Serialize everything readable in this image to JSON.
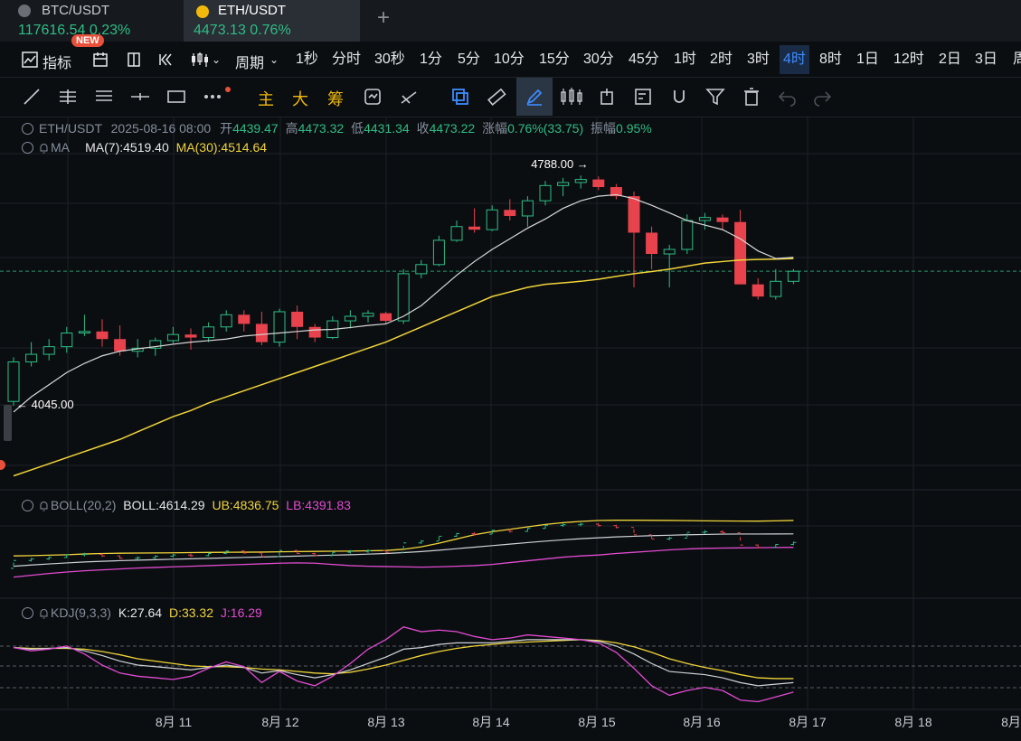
{
  "tabs": [
    {
      "symbol": "BTC/USDT",
      "price": "117616.54",
      "change": "0.23%",
      "badge": "NEW"
    },
    {
      "symbol": "ETH/USDT",
      "price": "4473.13",
      "change": "0.76%"
    }
  ],
  "toolbar": {
    "indicators_label": "指标",
    "period_label": "周期",
    "periods": [
      "1秒",
      "分时",
      "30秒",
      "1分",
      "5分",
      "10分",
      "15分",
      "30分",
      "45分",
      "1时",
      "2时",
      "3时",
      "4时",
      "8时",
      "1日",
      "12时",
      "2日",
      "3日",
      "周"
    ],
    "active_period": "4时"
  },
  "drawing_tools": {
    "main_label": "主",
    "big_label": "大",
    "chip_label": "筹"
  },
  "colors": {
    "up": "#2ebd85",
    "down": "#e8424c",
    "ma7": "#d8d8d8",
    "ma30": "#f0d43a",
    "boll_lb": "#e04bd0",
    "accent": "#3d8bfd"
  },
  "legend": {
    "symbol": "ETH/USDT",
    "datetime": "2025-08-16 08:00",
    "open_label": "开",
    "open": "4439.47",
    "high_label": "高",
    "high": "4473.32",
    "low_label": "低",
    "low": "4431.34",
    "close_label": "收",
    "close": "4473.22",
    "change_label": "涨幅",
    "change": "0.76%(33.75)",
    "amplitude_label": "振幅",
    "amplitude": "0.95%",
    "ma_name": "MA",
    "ma7": "MA(7):4519.40",
    "ma30": "MA(30):4514.64",
    "boll_name": "BOLL(20,2)",
    "boll": "BOLL:4614.29",
    "boll_ub": "UB:4836.75",
    "boll_lb": "LB:4391.83",
    "kdj_name": "KDJ(9,3,3)",
    "kdj_k": "K:27.64",
    "kdj_d": "D:33.32",
    "kdj_j": "J:16.29"
  },
  "chart_data": {
    "type": "candlestick",
    "interval": "4h",
    "x_ticks": [
      "8月 11",
      "8月 12",
      "8月 13",
      "8月 14",
      "8月 15",
      "8月 16",
      "8月 17",
      "8月 18",
      "8月"
    ],
    "price_range": [
      3790,
      4860
    ],
    "annotations": {
      "high_label": "4788.00",
      "low_label": "4045.00"
    },
    "last_price": 4473.13,
    "candles": [
      {
        "o": 4045,
        "h": 4190,
        "l": 4030,
        "c": 4175
      },
      {
        "o": 4175,
        "h": 4240,
        "l": 4160,
        "c": 4200
      },
      {
        "o": 4200,
        "h": 4250,
        "l": 4180,
        "c": 4225
      },
      {
        "o": 4225,
        "h": 4290,
        "l": 4205,
        "c": 4270
      },
      {
        "o": 4270,
        "h": 4330,
        "l": 4260,
        "c": 4275
      },
      {
        "o": 4275,
        "h": 4315,
        "l": 4225,
        "c": 4250
      },
      {
        "o": 4250,
        "h": 4295,
        "l": 4195,
        "c": 4210
      },
      {
        "o": 4210,
        "h": 4250,
        "l": 4190,
        "c": 4220
      },
      {
        "o": 4220,
        "h": 4255,
        "l": 4195,
        "c": 4245
      },
      {
        "o": 4245,
        "h": 4290,
        "l": 4235,
        "c": 4265
      },
      {
        "o": 4265,
        "h": 4285,
        "l": 4215,
        "c": 4255
      },
      {
        "o": 4255,
        "h": 4305,
        "l": 4240,
        "c": 4290
      },
      {
        "o": 4290,
        "h": 4345,
        "l": 4275,
        "c": 4330
      },
      {
        "o": 4330,
        "h": 4345,
        "l": 4275,
        "c": 4300
      },
      {
        "o": 4300,
        "h": 4340,
        "l": 4230,
        "c": 4240
      },
      {
        "o": 4240,
        "h": 4350,
        "l": 4225,
        "c": 4340
      },
      {
        "o": 4340,
        "h": 4360,
        "l": 4250,
        "c": 4290
      },
      {
        "o": 4290,
        "h": 4300,
        "l": 4240,
        "c": 4255
      },
      {
        "o": 4255,
        "h": 4325,
        "l": 4250,
        "c": 4310
      },
      {
        "o": 4310,
        "h": 4345,
        "l": 4285,
        "c": 4325
      },
      {
        "o": 4325,
        "h": 4345,
        "l": 4305,
        "c": 4335
      },
      {
        "o": 4335,
        "h": 4340,
        "l": 4300,
        "c": 4310
      },
      {
        "o": 4310,
        "h": 4480,
        "l": 4300,
        "c": 4465
      },
      {
        "o": 4465,
        "h": 4510,
        "l": 4450,
        "c": 4495
      },
      {
        "o": 4495,
        "h": 4590,
        "l": 4490,
        "c": 4575
      },
      {
        "o": 4575,
        "h": 4640,
        "l": 4570,
        "c": 4620
      },
      {
        "o": 4620,
        "h": 4680,
        "l": 4600,
        "c": 4610
      },
      {
        "o": 4610,
        "h": 4690,
        "l": 4605,
        "c": 4675
      },
      {
        "o": 4675,
        "h": 4710,
        "l": 4640,
        "c": 4655
      },
      {
        "o": 4655,
        "h": 4720,
        "l": 4620,
        "c": 4705
      },
      {
        "o": 4705,
        "h": 4770,
        "l": 4690,
        "c": 4755
      },
      {
        "o": 4755,
        "h": 4780,
        "l": 4720,
        "c": 4765
      },
      {
        "o": 4765,
        "h": 4788,
        "l": 4745,
        "c": 4775
      },
      {
        "o": 4775,
        "h": 4785,
        "l": 4740,
        "c": 4750
      },
      {
        "o": 4750,
        "h": 4760,
        "l": 4710,
        "c": 4720
      },
      {
        "o": 4720,
        "h": 4735,
        "l": 4420,
        "c": 4600
      },
      {
        "o": 4600,
        "h": 4620,
        "l": 4480,
        "c": 4530
      },
      {
        "o": 4530,
        "h": 4560,
        "l": 4420,
        "c": 4545
      },
      {
        "o": 4545,
        "h": 4660,
        "l": 4530,
        "c": 4640
      },
      {
        "o": 4640,
        "h": 4665,
        "l": 4610,
        "c": 4650
      },
      {
        "o": 4650,
        "h": 4660,
        "l": 4610,
        "c": 4635
      },
      {
        "o": 4635,
        "h": 4675,
        "l": 4490,
        "c": 4430
      },
      {
        "o": 4430,
        "h": 4450,
        "l": 4380,
        "c": 4390
      },
      {
        "o": 4390,
        "h": 4480,
        "l": 4380,
        "c": 4440
      },
      {
        "o": 4440,
        "h": 4480,
        "l": 4431,
        "c": 4473
      }
    ],
    "ma7": [
      4010,
      4060,
      4100,
      4140,
      4170,
      4195,
      4210,
      4218,
      4225,
      4233,
      4240,
      4245,
      4250,
      4260,
      4265,
      4270,
      4275,
      4280,
      4282,
      4288,
      4295,
      4300,
      4325,
      4360,
      4410,
      4460,
      4505,
      4545,
      4580,
      4615,
      4645,
      4680,
      4705,
      4720,
      4725,
      4712,
      4690,
      4665,
      4640,
      4625,
      4610,
      4580,
      4540,
      4515,
      4519
    ],
    "ma30": [
      3800,
      3820,
      3840,
      3860,
      3880,
      3900,
      3920,
      3945,
      3970,
      3995,
      4015,
      4040,
      4060,
      4080,
      4100,
      4120,
      4140,
      4160,
      4180,
      4200,
      4220,
      4240,
      4265,
      4290,
      4315,
      4340,
      4365,
      4390,
      4405,
      4420,
      4430,
      4435,
      4440,
      4447,
      4456,
      4465,
      4472,
      4480,
      4490,
      4500,
      4505,
      4510,
      4512,
      4513,
      4515
    ],
    "boll": {
      "ub_range_note": "",
      "ub": [
        4250,
        4255,
        4262,
        4270,
        4282,
        4290,
        4295,
        4298,
        4300,
        4302,
        4305,
        4308,
        4310,
        4312,
        4314,
        4318,
        4322,
        4325,
        4328,
        4330,
        4335,
        4340,
        4360,
        4400,
        4460,
        4530,
        4600,
        4650,
        4690,
        4730,
        4770,
        4800,
        4820,
        4835,
        4840,
        4840,
        4838,
        4836,
        4833,
        4830,
        4828,
        4826,
        4825,
        4830,
        4836
      ],
      "mid": [
        4080,
        4100,
        4118,
        4135,
        4150,
        4162,
        4172,
        4180,
        4188,
        4196,
        4203,
        4210,
        4218,
        4226,
        4233,
        4240,
        4248,
        4256,
        4263,
        4270,
        4280,
        4290,
        4305,
        4322,
        4345,
        4370,
        4395,
        4420,
        4445,
        4470,
        4495,
        4515,
        4535,
        4550,
        4565,
        4575,
        4585,
        4592,
        4600,
        4605,
        4610,
        4612,
        4612,
        4613,
        4614
      ],
      "lb": [
        3900,
        3930,
        3960,
        3985,
        4005,
        4020,
        4035,
        4050,
        4060,
        4070,
        4080,
        4090,
        4100,
        4110,
        4120,
        4130,
        4135,
        4130,
        4110,
        4090,
        4080,
        4075,
        4070,
        4065,
        4070,
        4080,
        4090,
        4110,
        4140,
        4170,
        4200,
        4230,
        4250,
        4265,
        4290,
        4310,
        4330,
        4350,
        4365,
        4375,
        4380,
        4383,
        4386,
        4389,
        4392
      ]
    },
    "kdj": {
      "k": [
        72,
        70,
        71,
        72,
        68,
        62,
        55,
        50,
        48,
        46,
        44,
        47,
        50,
        47,
        40,
        43,
        38,
        34,
        38,
        44,
        52,
        60,
        70,
        72,
        76,
        78,
        78,
        78,
        80,
        82,
        82,
        82,
        82,
        80,
        74,
        64,
        52,
        42,
        40,
        38,
        34,
        28,
        24,
        26,
        28
      ],
      "d": [
        72,
        71,
        71,
        71,
        70,
        67,
        63,
        58,
        55,
        52,
        49,
        48,
        48,
        47,
        45,
        44,
        42,
        40,
        39,
        41,
        45,
        50,
        56,
        62,
        67,
        71,
        74,
        76,
        78,
        79,
        80,
        81,
        82,
        81,
        78,
        73,
        66,
        58,
        52,
        47,
        43,
        38,
        34,
        33,
        33
      ],
      "j": [
        72,
        68,
        70,
        74,
        64,
        50,
        40,
        36,
        34,
        32,
        36,
        46,
        54,
        48,
        28,
        42,
        30,
        24,
        36,
        52,
        70,
        82,
        98,
        92,
        94,
        92,
        86,
        82,
        84,
        88,
        86,
        84,
        82,
        78,
        66,
        46,
        24,
        12,
        18,
        22,
        18,
        6,
        4,
        10,
        16
      ]
    }
  }
}
